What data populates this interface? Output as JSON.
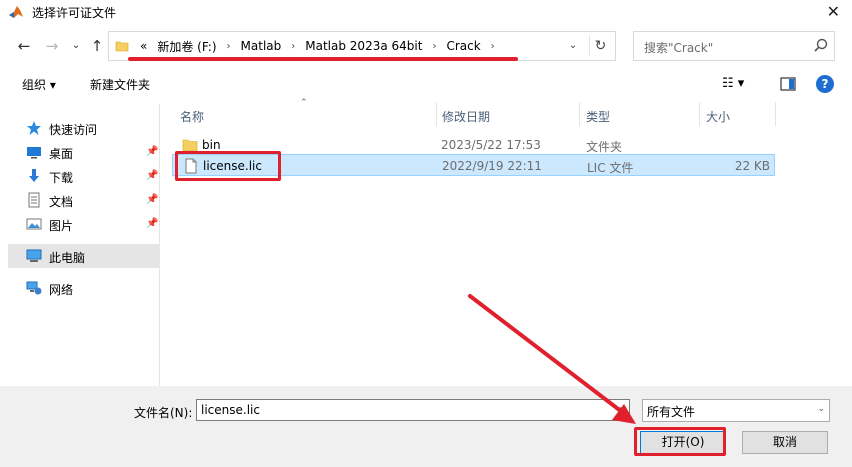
{
  "window": {
    "title": "选择许可证文件",
    "close": "✕"
  },
  "address": {
    "overflow": "«",
    "crumbs": [
      "新加卷 (F:)",
      "Matlab",
      "Matlab 2023a 64bit",
      "Crack"
    ]
  },
  "search": {
    "placeholder": "搜索\"Crack\""
  },
  "toolbar": {
    "organize": "组织 ▾",
    "new_folder": "新建文件夹",
    "help": "?"
  },
  "sidebar": {
    "items": [
      {
        "label": "快速访问",
        "icon": "star-icon"
      },
      {
        "label": "桌面",
        "icon": "desktop-icon"
      },
      {
        "label": "下载",
        "icon": "download-icon"
      },
      {
        "label": "文档",
        "icon": "document-icon"
      },
      {
        "label": "图片",
        "icon": "picture-icon"
      },
      {
        "label": "此电脑",
        "icon": "computer-icon"
      },
      {
        "label": "网络",
        "icon": "network-icon"
      }
    ]
  },
  "columns": {
    "name": "名称",
    "date": "修改日期",
    "type": "类型",
    "size": "大小"
  },
  "files": [
    {
      "name": "bin",
      "date": "2023/5/22 17:53",
      "type": "文件夹",
      "size": ""
    },
    {
      "name": "license.lic",
      "date": "2022/9/19 22:11",
      "type": "LIC 文件",
      "size": "22 KB"
    }
  ],
  "bottom": {
    "filename_label": "文件名(N):",
    "filename_value": "license.lic",
    "filter": "所有文件",
    "open": "打开(O)",
    "cancel": "取消"
  },
  "colors": {
    "highlight": "#e0202c",
    "selection": "#cce8ff"
  }
}
